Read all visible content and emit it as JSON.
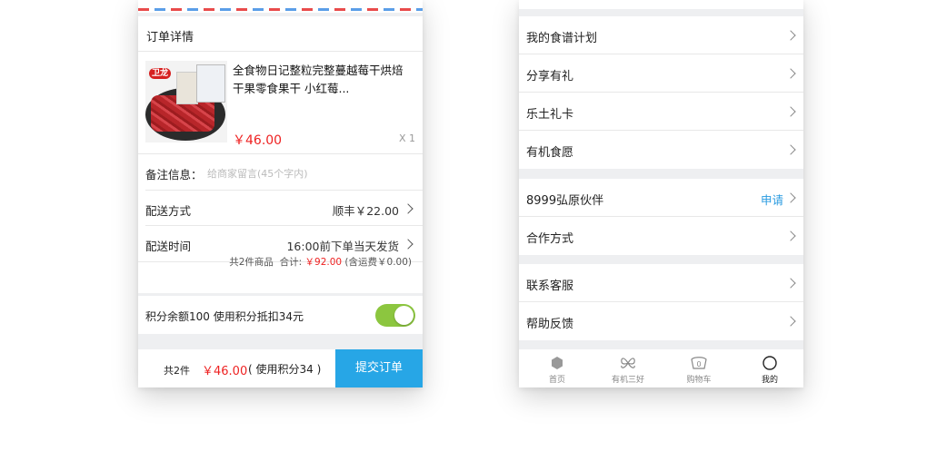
{
  "order": {
    "section_title": "订单详情",
    "product": {
      "brand": "卫龙",
      "name": "全食物日记整粒完整蔓越莓干烘焙干果零食果干 小红莓...",
      "price": "￥46.00",
      "quantity": "X 1"
    },
    "remark": {
      "label": "备注信息：",
      "placeholder": "给商家留言(45个字内)"
    },
    "delivery_method": {
      "label": "配送方式",
      "value": "顺丰￥22.00"
    },
    "delivery_time": {
      "label": "配送时间",
      "value": "16:00前下单当天发货"
    },
    "summary": {
      "count_text": "共2件商品",
      "total_label": "合计:",
      "total_value": "￥92.00",
      "shipping_note": "(含运费￥0.00)"
    },
    "points": {
      "text": "积分余额100  使用积分抵扣34元",
      "enabled": true,
      "toggle_color": "#8cc63f"
    }
  },
  "checkout_bar": {
    "count": "共2件",
    "price": "￥46.00",
    "points_note": "( 使用积分34 )",
    "submit_label": "提交订单",
    "submit_color": "#27a6e6"
  },
  "menu": {
    "groups": [
      {
        "items": [
          {
            "label": "我的食谱计划"
          },
          {
            "label": "分享有礼"
          },
          {
            "label": "乐土礼卡"
          },
          {
            "label": "有机食愿"
          }
        ]
      },
      {
        "items": [
          {
            "label": "8999弘原伙伴",
            "extra": "申请"
          },
          {
            "label": "合作方式"
          }
        ]
      },
      {
        "items": [
          {
            "label": "联系客服"
          },
          {
            "label": "帮助反馈"
          }
        ]
      }
    ],
    "accent_color": "#2a9be0"
  },
  "tabbar": {
    "tabs": [
      {
        "label": "首页",
        "icon": "home-icon"
      },
      {
        "label": "有机三好",
        "icon": "leaf-icon"
      },
      {
        "label": "购物车",
        "icon": "cart-icon",
        "badge": "0"
      },
      {
        "label": "我的",
        "icon": "profile-icon",
        "active": true
      }
    ]
  }
}
